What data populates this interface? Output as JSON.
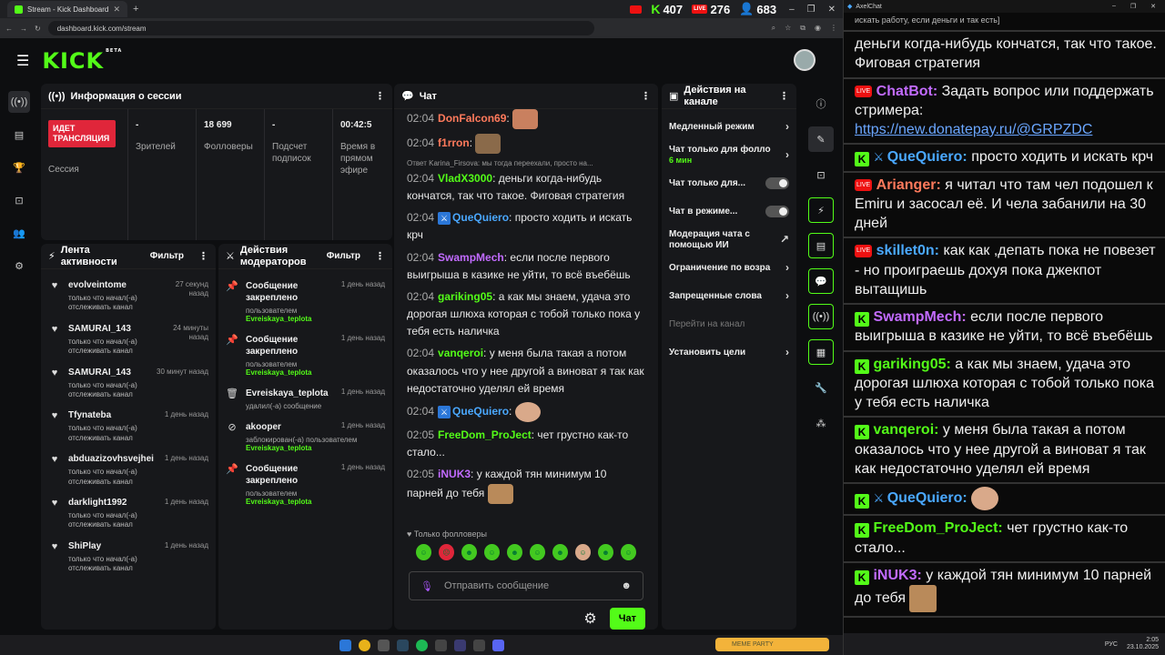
{
  "browser": {
    "tab_title": "Stream - Kick Dashboard",
    "new_tab": "+",
    "url": "dashboard.kick.com/stream",
    "stats": {
      "kick": "407",
      "live": "276",
      "viewers": "683"
    },
    "window_controls": [
      "–",
      "❐",
      "✕"
    ]
  },
  "kick": {
    "logo": "KICK",
    "beta": "BETA"
  },
  "session": {
    "title": "Информация о сессии",
    "live_badge": "ИДЕТ ТРАНСЛЯЦИЯ",
    "session_label": "Сессия",
    "viewers_value": "-",
    "viewers_label": "Зрителей",
    "followers_value": "18 699",
    "followers_label": "Фолловеры",
    "subs_value": "-",
    "subs_label": "Подсчет подписок",
    "time_value": "00:42:5",
    "time_label": "Время в прямом эфире"
  },
  "feed": {
    "title": "Лента активности",
    "filter": "Фильтр",
    "items": [
      {
        "name": "evolveintome",
        "time": "27 секунд назад",
        "desc": "только что начал(-а) отслеживать канал"
      },
      {
        "name": "SAMURAI_143",
        "time": "24 минуты назад",
        "desc": "только что начал(-а) отслеживать канал"
      },
      {
        "name": "SAMURAI_143",
        "time": "30 минут назад",
        "desc": "только что начал(-а) отслеживать канал"
      },
      {
        "name": "Tfynateba",
        "time": "1 день назад",
        "desc": "только что начал(-а) отслеживать канал"
      },
      {
        "name": "abduazizovhsvejhei",
        "time": "1 день назад",
        "desc": "только что начал(-а) отслеживать канал"
      },
      {
        "name": "darklight1992",
        "time": "1 день назад",
        "desc": "только что начал(-а) отслеживать канал"
      },
      {
        "name": "ShiPlay",
        "time": "1 день назад",
        "desc": "только что начал(-а) отслеживать канал"
      }
    ]
  },
  "modactions": {
    "title": "Действия модераторов",
    "filter": "Фильтр",
    "items": [
      {
        "title": "Сообщение закреплено",
        "time": "1 день назад",
        "sub": "пользователем",
        "user": "Evreiskaya_teplota"
      },
      {
        "title": "Сообщение закреплено",
        "time": "1 день назад",
        "sub": "пользователем",
        "user": "Evreiskaya_teplota"
      },
      {
        "title": "Evreiskaya_teplota",
        "time": "1 день назад",
        "sub": "удалил(-а) сообщение",
        "user": ""
      },
      {
        "title": "akooper",
        "time": "1 день назад",
        "sub": "заблокирован(-а) пользователем",
        "user": "Evreiskaya_teplota"
      },
      {
        "title": "Сообщение закреплено",
        "time": "1 день назад",
        "sub": "пользователем",
        "user": "Evreiskaya_teplota"
      }
    ]
  },
  "chat": {
    "title": "Чат",
    "reply_line": "Ответ Karina_Firsova: мы тогда переехали, просто на...",
    "messages": [
      {
        "time": "02:04",
        "user": "DonFalcon69",
        "color": "#ff7a5c",
        "text": ""
      },
      {
        "time": "02:04",
        "user": "f1rron",
        "color": "#ff7a5c",
        "text": ""
      },
      {
        "time": "02:04",
        "user": "VladX3000",
        "color": "#53fc18",
        "text": "деньги когда-нибудь кончатся, так что такое. Фиговая стратегия"
      },
      {
        "time": "02:04",
        "user": "QueQuiero",
        "color": "#4aa8ff",
        "text": "просто ходить и искать крч"
      },
      {
        "time": "02:04",
        "user": "SwampMech",
        "color": "#c26bff",
        "text": "если после первого выигрыша в казике не уйти, то всё въебёшь"
      },
      {
        "time": "02:04",
        "user": "gariking05",
        "color": "#53fc18",
        "text": "а как мы знаем, удача это дорогая шлюха которая с тобой только пока у тебя есть наличка"
      },
      {
        "time": "02:04",
        "user": "vanqeroi",
        "color": "#53fc18",
        "text": "у меня была такая а потом оказалось что у нее другой а виноват я так как недостаточно уделял ей время"
      },
      {
        "time": "02:04",
        "user": "QueQuiero",
        "color": "#4aa8ff",
        "text": ""
      },
      {
        "time": "02:05",
        "user": "FreeDom_ProJect",
        "color": "#53fc18",
        "text": "чет грустно как-то стало..."
      },
      {
        "time": "02:05",
        "user": "iNUK3",
        "color": "#c26bff",
        "text": "у каждой тян минимум 10 парней до тебя"
      }
    ],
    "followers_only": "Только фолловеры",
    "placeholder": "Отправить сообщение",
    "send": "Чат"
  },
  "actions": {
    "title": "Действия на канале",
    "items": [
      {
        "label": "Медленный режим",
        "sub": "",
        "control": "chevron"
      },
      {
        "label": "Чат только для фолло",
        "sub": "6 мин",
        "control": "chevron"
      },
      {
        "label": "Чат только для...",
        "sub": "",
        "control": "toggle"
      },
      {
        "label": "Чат в режиме...",
        "sub": "",
        "control": "toggle"
      },
      {
        "label": "Модерация чата с помощью ИИ",
        "sub": "",
        "control": "external"
      },
      {
        "label": "Ограничение по возра",
        "sub": "",
        "control": "chevron"
      },
      {
        "label": "Запрещенные слова",
        "sub": "",
        "control": "chevron"
      },
      {
        "label": "Перейти на канал",
        "sub": "",
        "control": "none"
      },
      {
        "label": "Установить цели",
        "sub": "",
        "control": "chevron"
      }
    ]
  },
  "taskbar": {
    "meme": "MEME PARTY",
    "lang": "РУС",
    "time": "2:05",
    "date": "23.10.2025"
  },
  "axel": {
    "title": "AxelChat",
    "messages": [
      {
        "platform": "",
        "user": "",
        "text": "искать работу, если деньги и так есть]"
      },
      {
        "platform": "",
        "user": "",
        "text": "деньги когда-нибудь кончатся, так что такое. Фиговая стратегия"
      },
      {
        "platform": "live",
        "user": "ChatBot:",
        "color": "#c26bff",
        "text": "Задать вопрос или поддержать стримера:",
        "link": "https://new.donatepay.ru/@GRPZDC"
      },
      {
        "platform": "kick",
        "user": "QueQuiero:",
        "color": "#4aa8ff",
        "text": "просто ходить и искать крч"
      },
      {
        "platform": "live",
        "user": "Arianger:",
        "color": "#ff7a5c",
        "text": "я читал что там чел подошел к Emiru и засосал её. И чела забанили на 30 дней"
      },
      {
        "platform": "live",
        "user": "skillet0n:",
        "color": "#4aa8ff",
        "text": "как как ,депать пока не повезет - но проиграешь дохуя пока джекпот вытащишь"
      },
      {
        "platform": "kick",
        "user": "SwampMech:",
        "color": "#c26bff",
        "text": "если после первого выигрыша в казике не уйти, то всё въебёшь"
      },
      {
        "platform": "kick",
        "user": "gariking05:",
        "color": "#53fc18",
        "text": "а как мы знаем, удача это дорогая шлюха которая с тобой только пока у тебя есть наличка"
      },
      {
        "platform": "kick",
        "user": "vanqeroi:",
        "color": "#53fc18",
        "text": "у меня была такая а потом оказалось что у нее другой а виноват я так как недостаточно уделял ей время"
      },
      {
        "platform": "kick",
        "user": "QueQuiero:",
        "color": "#4aa8ff",
        "text": ""
      },
      {
        "platform": "kick",
        "user": "FreeDom_ProJect:",
        "color": "#53fc18",
        "text": "чет грустно как-то стало..."
      },
      {
        "platform": "kick",
        "user": "iNUK3:",
        "color": "#c26bff",
        "text": "у каждой тян минимум 10 парней до тебя"
      }
    ]
  }
}
